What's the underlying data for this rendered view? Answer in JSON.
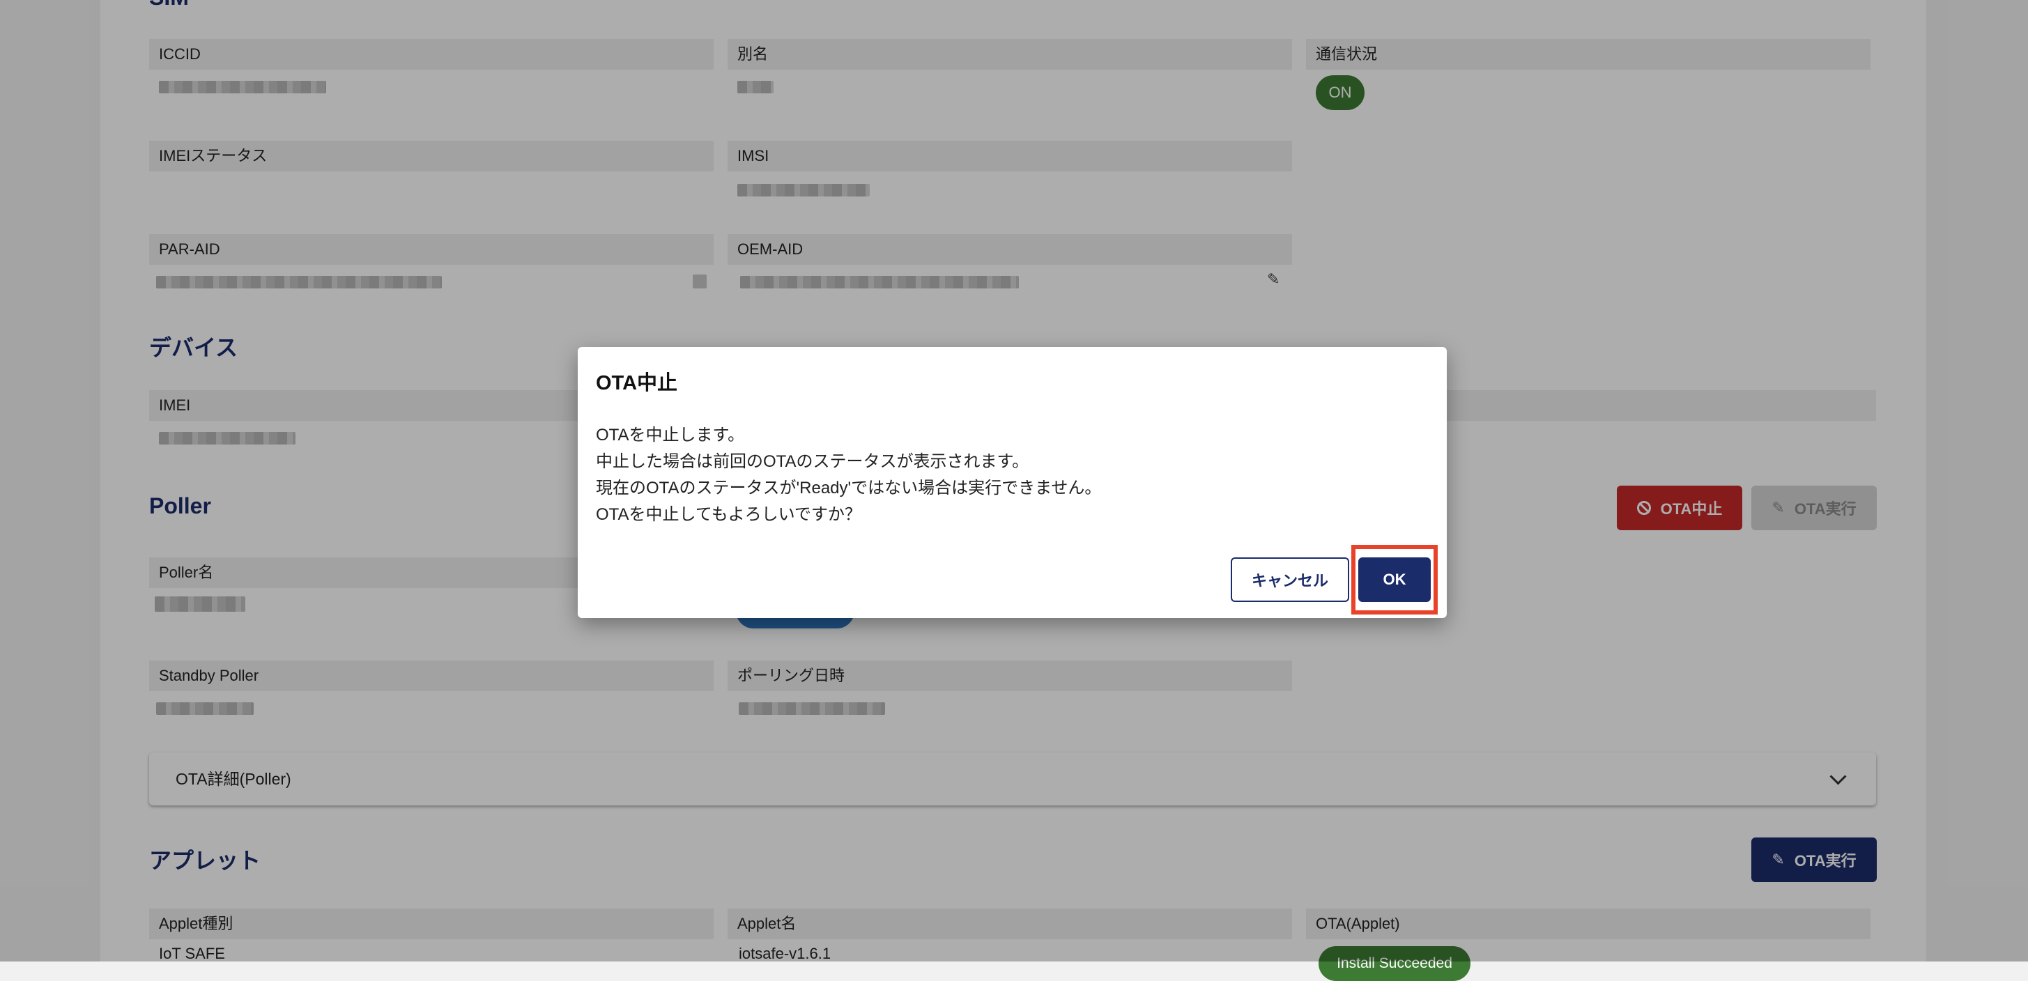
{
  "sim": {
    "fields": [
      {
        "label": "ICCID"
      },
      {
        "label": "別名"
      },
      {
        "label": "通信状況",
        "badge": "ON"
      },
      {
        "label": "IMEIステータス"
      },
      {
        "label": "IMSI"
      },
      {
        "label": "PAR-AID"
      },
      {
        "label": "OEM-AID"
      }
    ]
  },
  "device": {
    "title": "デバイス",
    "imei_label": "IMEI"
  },
  "poller": {
    "title": "Poller",
    "ota_stop_label": "OTA中止",
    "ota_exec_label": "OTA実行",
    "poller_name_label": "Poller名",
    "standby_label": "Standby Poller",
    "polling_time_label": "ポーリング日時",
    "accordion_label": "OTA詳細(Poller)"
  },
  "applet": {
    "title": "アプレット",
    "ota_exec_label": "OTA実行",
    "type_label": "Applet種別",
    "type_value": "IoT SAFE",
    "name_label": "Applet名",
    "name_value": "iotsafe-v1.6.1",
    "ota_label": "OTA(Applet)",
    "ota_badge": "Install Succeeded"
  },
  "dialog": {
    "title": "OTA中止",
    "lines": [
      "OTAを中止します。",
      "中止した場合は前回のOTAのステータスが表示されます。",
      "現在のOTAのステータスが'Ready'ではない場合は実行できません。",
      "OTAを中止してもよろしいですか？"
    ],
    "cancel_label": "キャンセル",
    "ok_label": "OK"
  },
  "colors": {
    "primary": "#1b2c6b",
    "danger": "#c62828",
    "success": "#3d7a33",
    "highlight": "#e8432a"
  },
  "icons": {
    "edit": "pencil-icon",
    "stop": "ban-icon",
    "expand": "chevron-down-icon"
  }
}
